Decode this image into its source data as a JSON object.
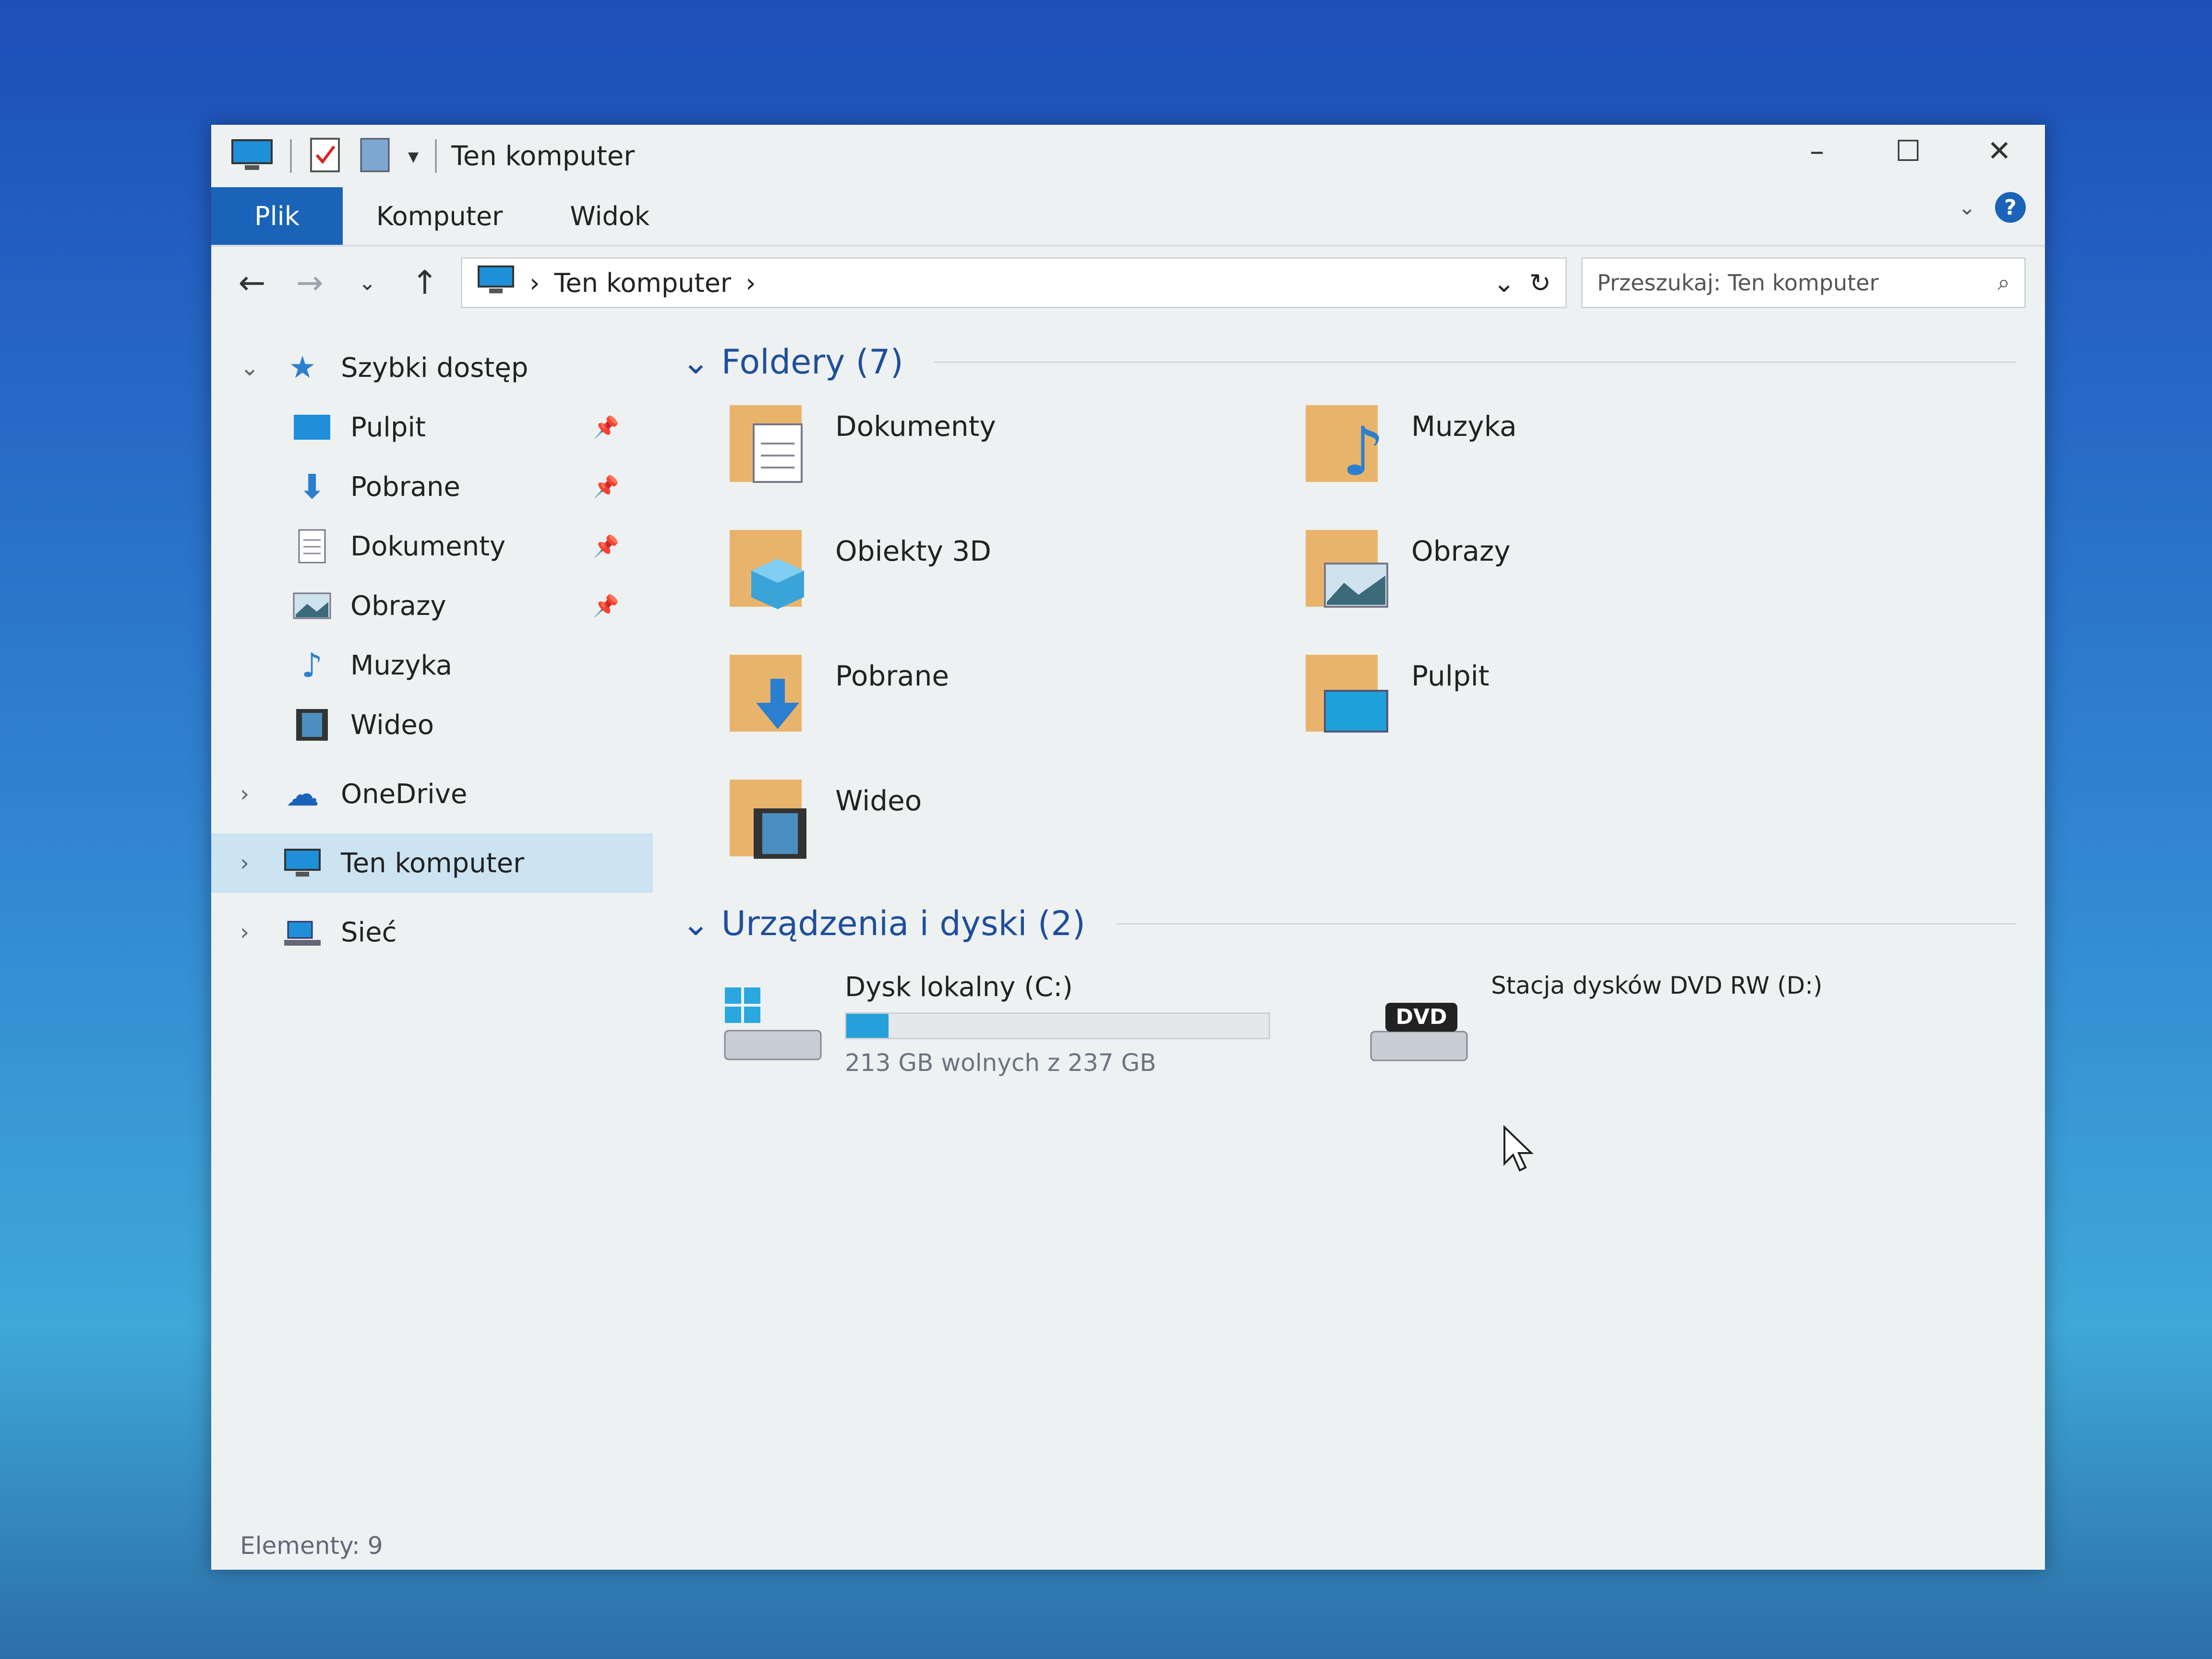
{
  "window": {
    "title": "Ten komputer",
    "controls": {
      "minimize": "–",
      "maximize": "☐",
      "close": "✕"
    }
  },
  "ribbon": {
    "tabs": [
      "Plik",
      "Komputer",
      "Widok"
    ],
    "help": "?"
  },
  "address": {
    "path": "Ten komputer",
    "search_placeholder": "Przeszukaj: Ten komputer"
  },
  "sidebar": {
    "quick_access": "Szybki dostęp",
    "pinned": [
      "Pulpit",
      "Pobrane",
      "Dokumenty",
      "Obrazy"
    ],
    "unpinned": [
      "Muzyka",
      "Wideo"
    ],
    "onedrive": "OneDrive",
    "this_pc": "Ten komputer",
    "network": "Sieć"
  },
  "content": {
    "folders_header": "Foldery (7)",
    "folders": [
      "Dokumenty",
      "Muzyka",
      "Obiekty 3D",
      "Obrazy",
      "Pobrane",
      "Pulpit",
      "Wideo"
    ],
    "devices_header": "Urządzenia i dyski (2)",
    "drive_c": {
      "name": "Dysk lokalny (C:)",
      "free": "213 GB wolnych z 237 GB",
      "used_fraction": 0.1
    },
    "drive_d": {
      "name": "Stacja dysków DVD RW (D:)",
      "badge": "DVD"
    }
  },
  "status": {
    "items": "Elementy: 9"
  },
  "colors": {
    "accent": "#1a63b8",
    "folder": "#e8b46c",
    "bar": "#26a0da"
  }
}
